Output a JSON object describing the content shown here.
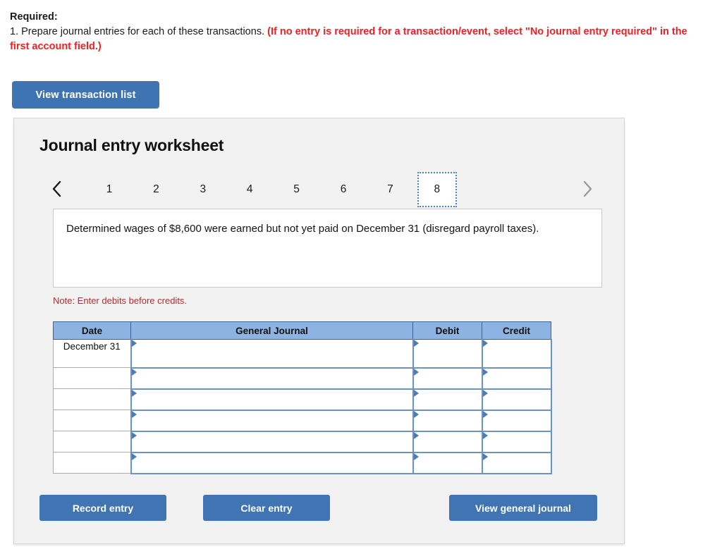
{
  "instructions": {
    "required_label": "Required:",
    "line_plain": "1. Prepare journal entries for each of these transactions. ",
    "line_red": "(If no entry is required for a transaction/event, select \"No journal entry required\" in the first account field.)"
  },
  "toolbar": {
    "view_transaction_list_label": "View transaction list"
  },
  "worksheet": {
    "title": "Journal entry worksheet",
    "tabs": [
      {
        "label": "1",
        "active": false
      },
      {
        "label": "2",
        "active": false
      },
      {
        "label": "3",
        "active": false
      },
      {
        "label": "4",
        "active": false
      },
      {
        "label": "5",
        "active": false
      },
      {
        "label": "6",
        "active": false
      },
      {
        "label": "7",
        "active": false
      },
      {
        "label": "8",
        "active": true
      }
    ],
    "prev_icon": "chevron-left-icon",
    "next_icon": "chevron-right-icon",
    "transaction_description": "Determined wages of $8,600 were earned but not yet paid on December 31 (disregard payroll taxes).",
    "note": "Note: Enter debits before credits."
  },
  "table": {
    "headers": [
      "Date",
      "General Journal",
      "Debit",
      "Credit"
    ],
    "rows": [
      {
        "date": "December 31",
        "general_journal": "",
        "debit": "",
        "credit": ""
      },
      {
        "date": "",
        "general_journal": "",
        "debit": "",
        "credit": ""
      },
      {
        "date": "",
        "general_journal": "",
        "debit": "",
        "credit": ""
      },
      {
        "date": "",
        "general_journal": "",
        "debit": "",
        "credit": ""
      },
      {
        "date": "",
        "general_journal": "",
        "debit": "",
        "credit": ""
      },
      {
        "date": "",
        "general_journal": "",
        "debit": "",
        "credit": ""
      }
    ]
  },
  "footer": {
    "record_entry_label": "Record entry",
    "clear_entry_label": "Clear entry",
    "view_general_journal_label": "View general journal"
  },
  "colors": {
    "button_blue": "#4074b2",
    "header_blue": "#8db3e2",
    "cell_border_blue": "#6a93c6",
    "note_red": "#a63232",
    "instruction_red": "#ee2222",
    "panel_bg": "#f2f2f2"
  }
}
